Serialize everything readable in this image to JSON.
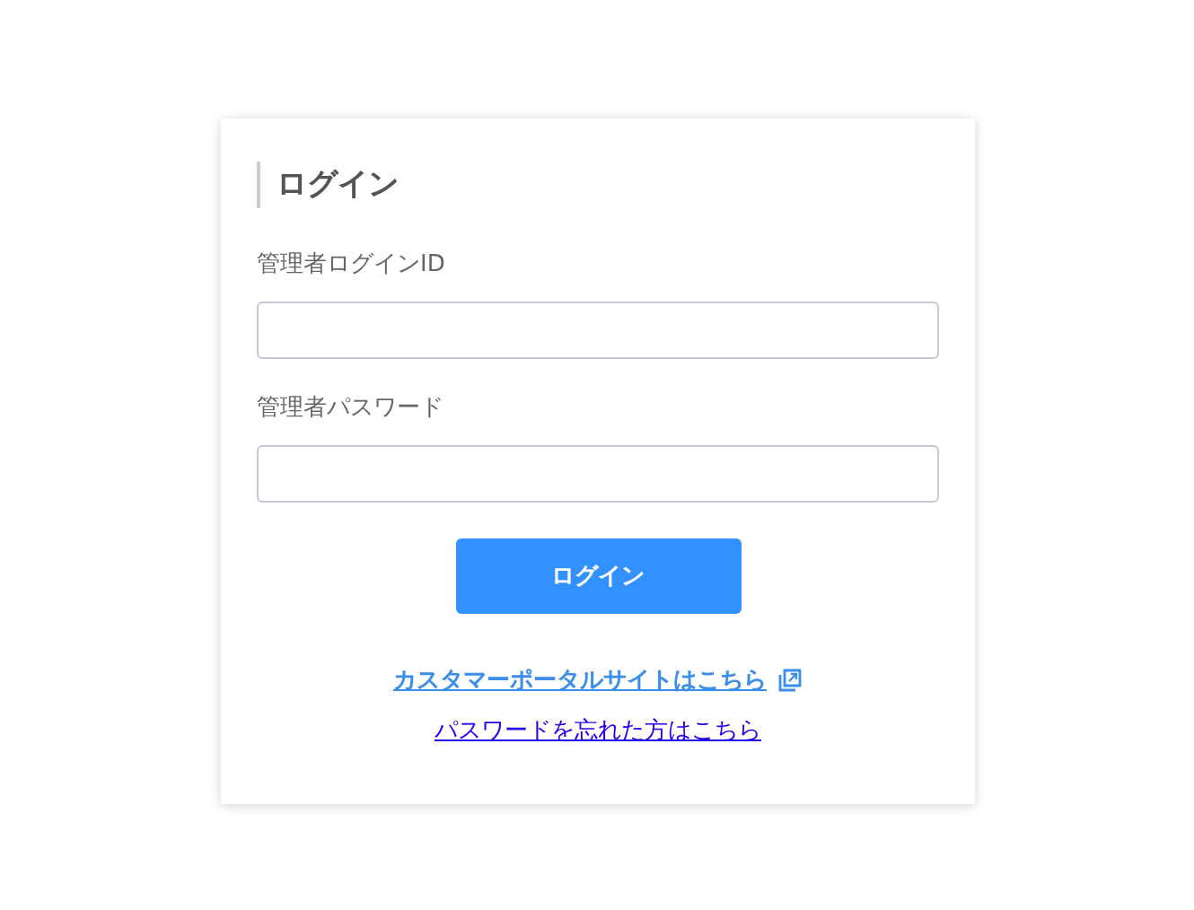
{
  "title": "ログイン",
  "fields": [
    {
      "label": "管理者ログインID"
    },
    {
      "label": "管理者パスワード"
    }
  ],
  "submit": "ログイン",
  "links": [
    {
      "kind": "external",
      "text": "カスタマーポータルサイトはこちら"
    },
    {
      "kind": "plain",
      "text": "パスワードを忘れた方はこちら"
    }
  ]
}
